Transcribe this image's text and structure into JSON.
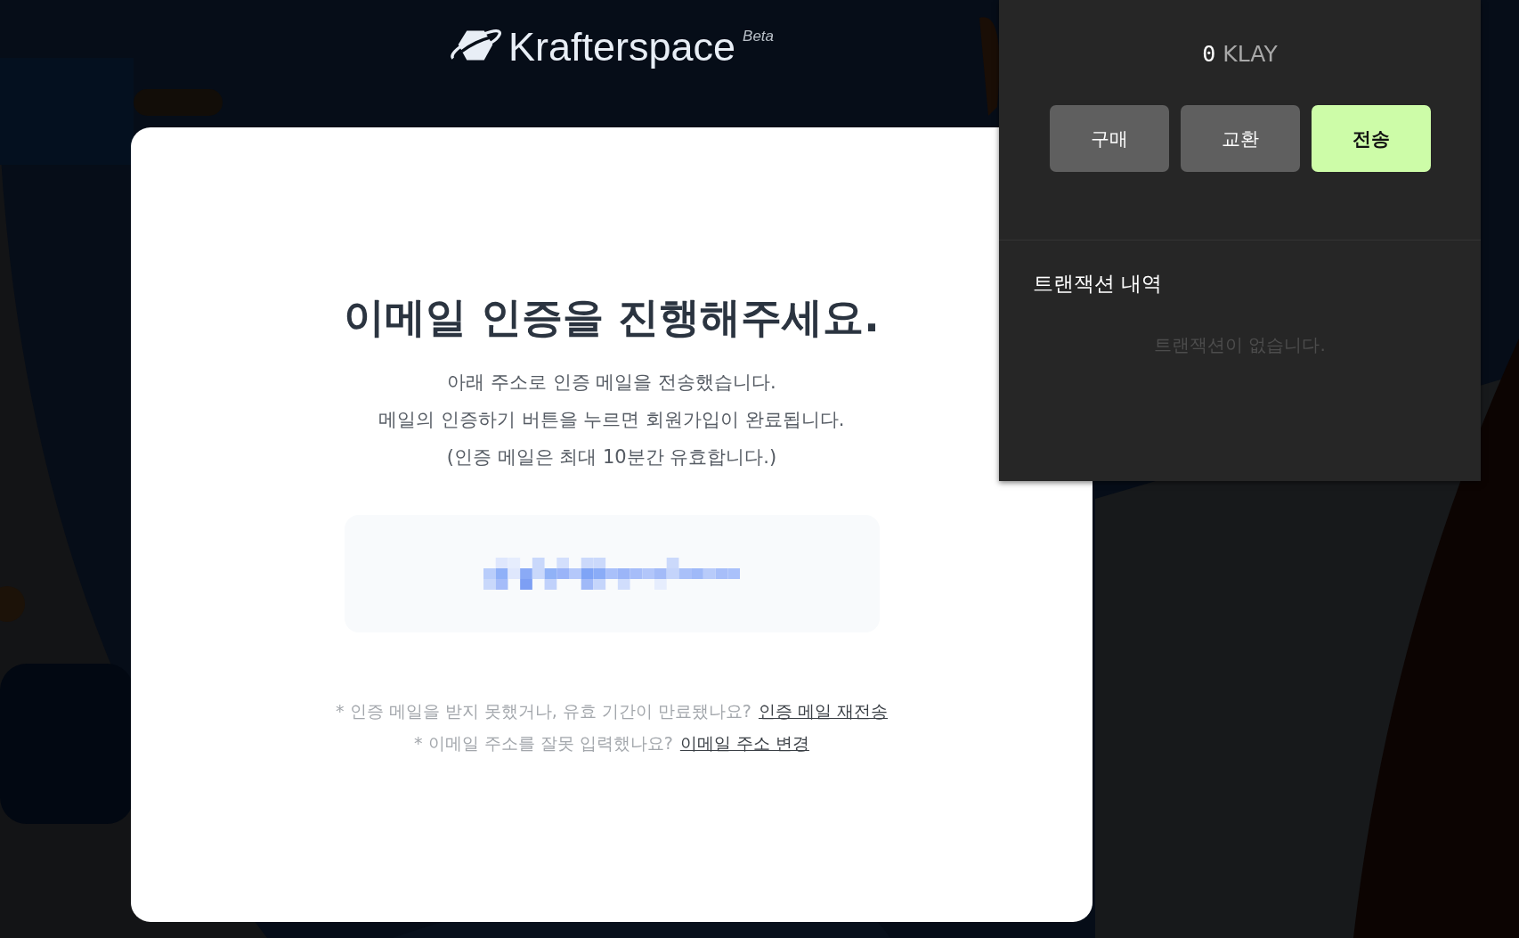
{
  "header": {
    "logo_text": "Krafterspace",
    "badge": "Beta"
  },
  "card": {
    "title": "이메일 인증을 진행해주세요.",
    "message_lines": [
      "아래 주소로 인증 메일을 전송했습니다.",
      "메일의 인증하기 버튼을 누르면 회원가입이 완료됩니다.",
      "(인증 메일은 최대 10분간 유효합니다.)"
    ],
    "email": {
      "kind": "redacted"
    },
    "notes": [
      {
        "text": "* 인증 메일을 받지 못했거나, 유효 기간이 만료됐나요?",
        "link": "인증 메일 재전송"
      },
      {
        "text": "* 이메일 주소를 잘못 입력했나요?",
        "link": "이메일 주소 변경"
      }
    ]
  },
  "wallet": {
    "amount": "0",
    "unit": "KLAY",
    "buttons": [
      {
        "label": "구매",
        "selected": false
      },
      {
        "label": "교환",
        "selected": false
      },
      {
        "label": "전송",
        "selected": true
      }
    ],
    "history_title": "트랜잭션 내역",
    "empty_text": "트랜잭션이 없습니다."
  }
}
